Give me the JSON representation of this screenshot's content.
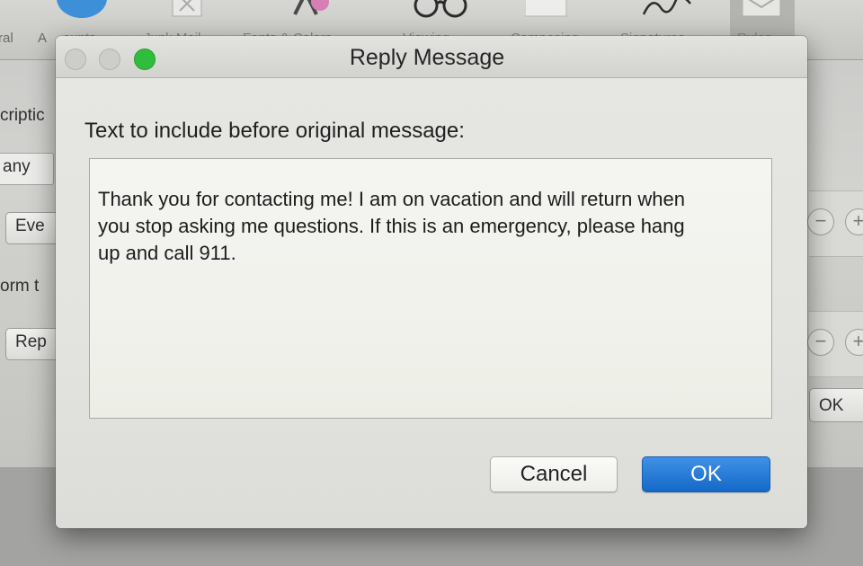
{
  "background": {
    "tabs": [
      "ral",
      "A",
      "ounts",
      "Junk Mail",
      "Fonts & Colors",
      "Viewing",
      "Composing",
      "Signatures",
      "Rules"
    ],
    "description_label": "criptic",
    "any_popup": "any",
    "every_popup": "Eve",
    "perform_label": "orm t",
    "reply_popup": "Rep",
    "ok_label": "OK"
  },
  "dialog": {
    "title": "Reply Message",
    "prompt": "Text to include before original message:",
    "message": "Thank you for contacting me! I am on vacation and will return when\nyou stop asking me questions. If this is an emergency, please hang\nup and call 911.",
    "cancel_label": "Cancel",
    "ok_label": "OK"
  },
  "colors": {
    "zoom_button": "#2fbd3b",
    "ok_button": "#1e74d6"
  }
}
